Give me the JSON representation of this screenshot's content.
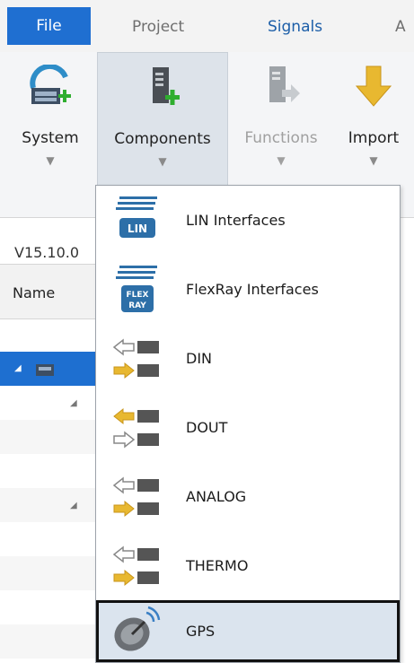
{
  "tabs": [
    {
      "label": "File"
    },
    {
      "label": "Project"
    },
    {
      "label": "Signals"
    },
    {
      "label": "A"
    }
  ],
  "ribbon": {
    "system_label": "System",
    "components_label": "Components",
    "functions_label": "Functions",
    "import_label": "Import"
  },
  "panel": {
    "version": "V15.10.0",
    "column_name": "Name"
  },
  "menu": {
    "items": [
      {
        "label": "LIN Interfaces",
        "icon": "lin-interface-icon"
      },
      {
        "label": "FlexRay Interfaces",
        "icon": "flexray-interface-icon"
      },
      {
        "label": "DIN",
        "icon": "din-icon"
      },
      {
        "label": "DOUT",
        "icon": "dout-icon"
      },
      {
        "label": "ANALOG",
        "icon": "analog-icon"
      },
      {
        "label": "THERMO",
        "icon": "thermo-icon"
      },
      {
        "label": "GPS",
        "icon": "gps-icon"
      }
    ],
    "hovered_item": "GPS"
  },
  "colors": {
    "file_tab": "#1f6fd1",
    "selected_row": "#1e6fd0",
    "hover_item": "#dbe4ee",
    "arrow_yellow": "#e8b830"
  }
}
